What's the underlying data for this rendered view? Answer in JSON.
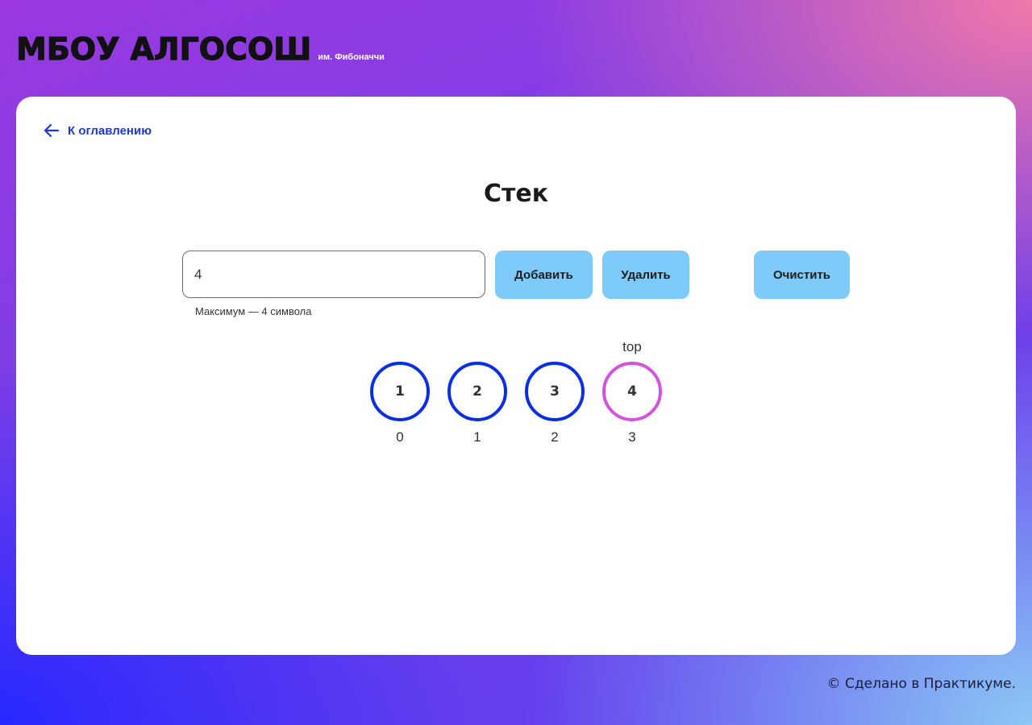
{
  "header": {
    "title": "МБОУ АЛГОСОШ",
    "subtitle": "им. Фибоначчи"
  },
  "nav": {
    "back_label": "К оглавлению"
  },
  "page": {
    "title": "Стек"
  },
  "form": {
    "input_value": "4",
    "hint": "Максимум — 4 символа",
    "add_label": "Добавить",
    "delete_label": "Удалить",
    "clear_label": "Очистить"
  },
  "stack": {
    "top_label": "top",
    "items": [
      {
        "value": "1",
        "index": "0",
        "is_top": false
      },
      {
        "value": "2",
        "index": "1",
        "is_top": false
      },
      {
        "value": "3",
        "index": "2",
        "is_top": false
      },
      {
        "value": "4",
        "index": "3",
        "is_top": true
      }
    ]
  },
  "footer": {
    "text": "© Сделано в Практикуме."
  },
  "colors": {
    "button_bg": "#7ecbfb",
    "circle_default": "#0a2de6",
    "circle_top": "#d253de",
    "link": "#1a39d8"
  }
}
